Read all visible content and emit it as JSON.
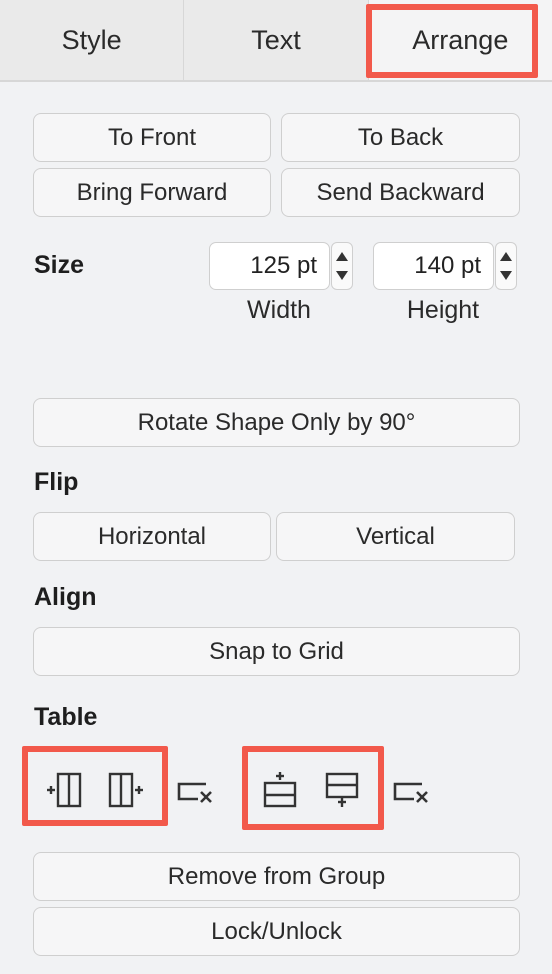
{
  "tabs": [
    {
      "label": "Style"
    },
    {
      "label": "Text"
    },
    {
      "label": "Arrange"
    }
  ],
  "order": {
    "to_front": "To Front",
    "to_back": "To Back",
    "bring_forward": "Bring Forward",
    "send_backward": "Send Backward"
  },
  "size": {
    "title": "Size",
    "width_value": "125 pt",
    "height_value": "140 pt",
    "width_label": "Width",
    "height_label": "Height"
  },
  "rotate": {
    "label": "Rotate Shape Only by 90°"
  },
  "flip": {
    "title": "Flip",
    "horizontal": "Horizontal",
    "vertical": "Vertical"
  },
  "align": {
    "title": "Align",
    "snap": "Snap to Grid"
  },
  "table": {
    "title": "Table",
    "icons": [
      "insert-column-before-icon",
      "insert-column-after-icon",
      "delete-column-icon",
      "insert-row-above-icon",
      "insert-row-below-icon",
      "delete-row-icon"
    ]
  },
  "group": {
    "remove": "Remove from Group",
    "lock": "Lock/Unlock"
  },
  "colors": {
    "highlight": "#f2594b",
    "background": "#f1f2f4"
  }
}
